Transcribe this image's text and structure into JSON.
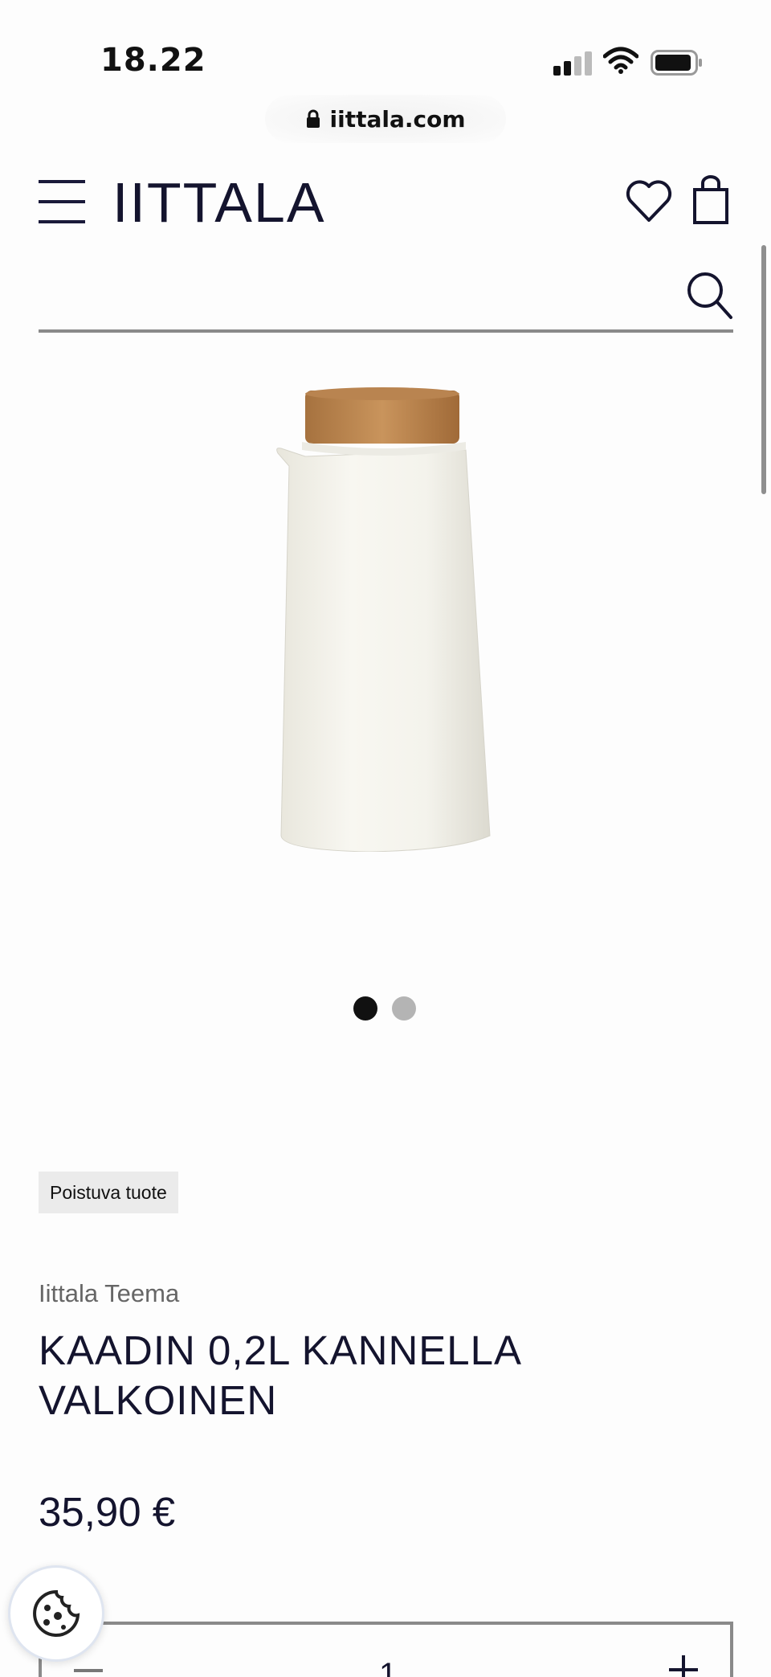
{
  "status_bar": {
    "time": "18.22"
  },
  "browser": {
    "url": "iittala.com"
  },
  "header": {
    "logo": "IITTALA"
  },
  "search": {
    "placeholder": ""
  },
  "gallery": {
    "image_count": 2,
    "active_index": 0
  },
  "product": {
    "badge": "Poistuva tuote",
    "collection": "Iittala Teema",
    "title": "KAADIN 0,2L KANNELLA VALKOINEN",
    "price": "35,90 €"
  },
  "quantity": {
    "value": "1"
  },
  "icons": [
    "lock-icon",
    "menu-icon",
    "heart-icon",
    "bag-icon",
    "search-icon",
    "cookie-icon"
  ],
  "colors": {
    "navy": "#14142e",
    "border": "#8a8a8a",
    "badge_bg": "#ebebeb"
  }
}
